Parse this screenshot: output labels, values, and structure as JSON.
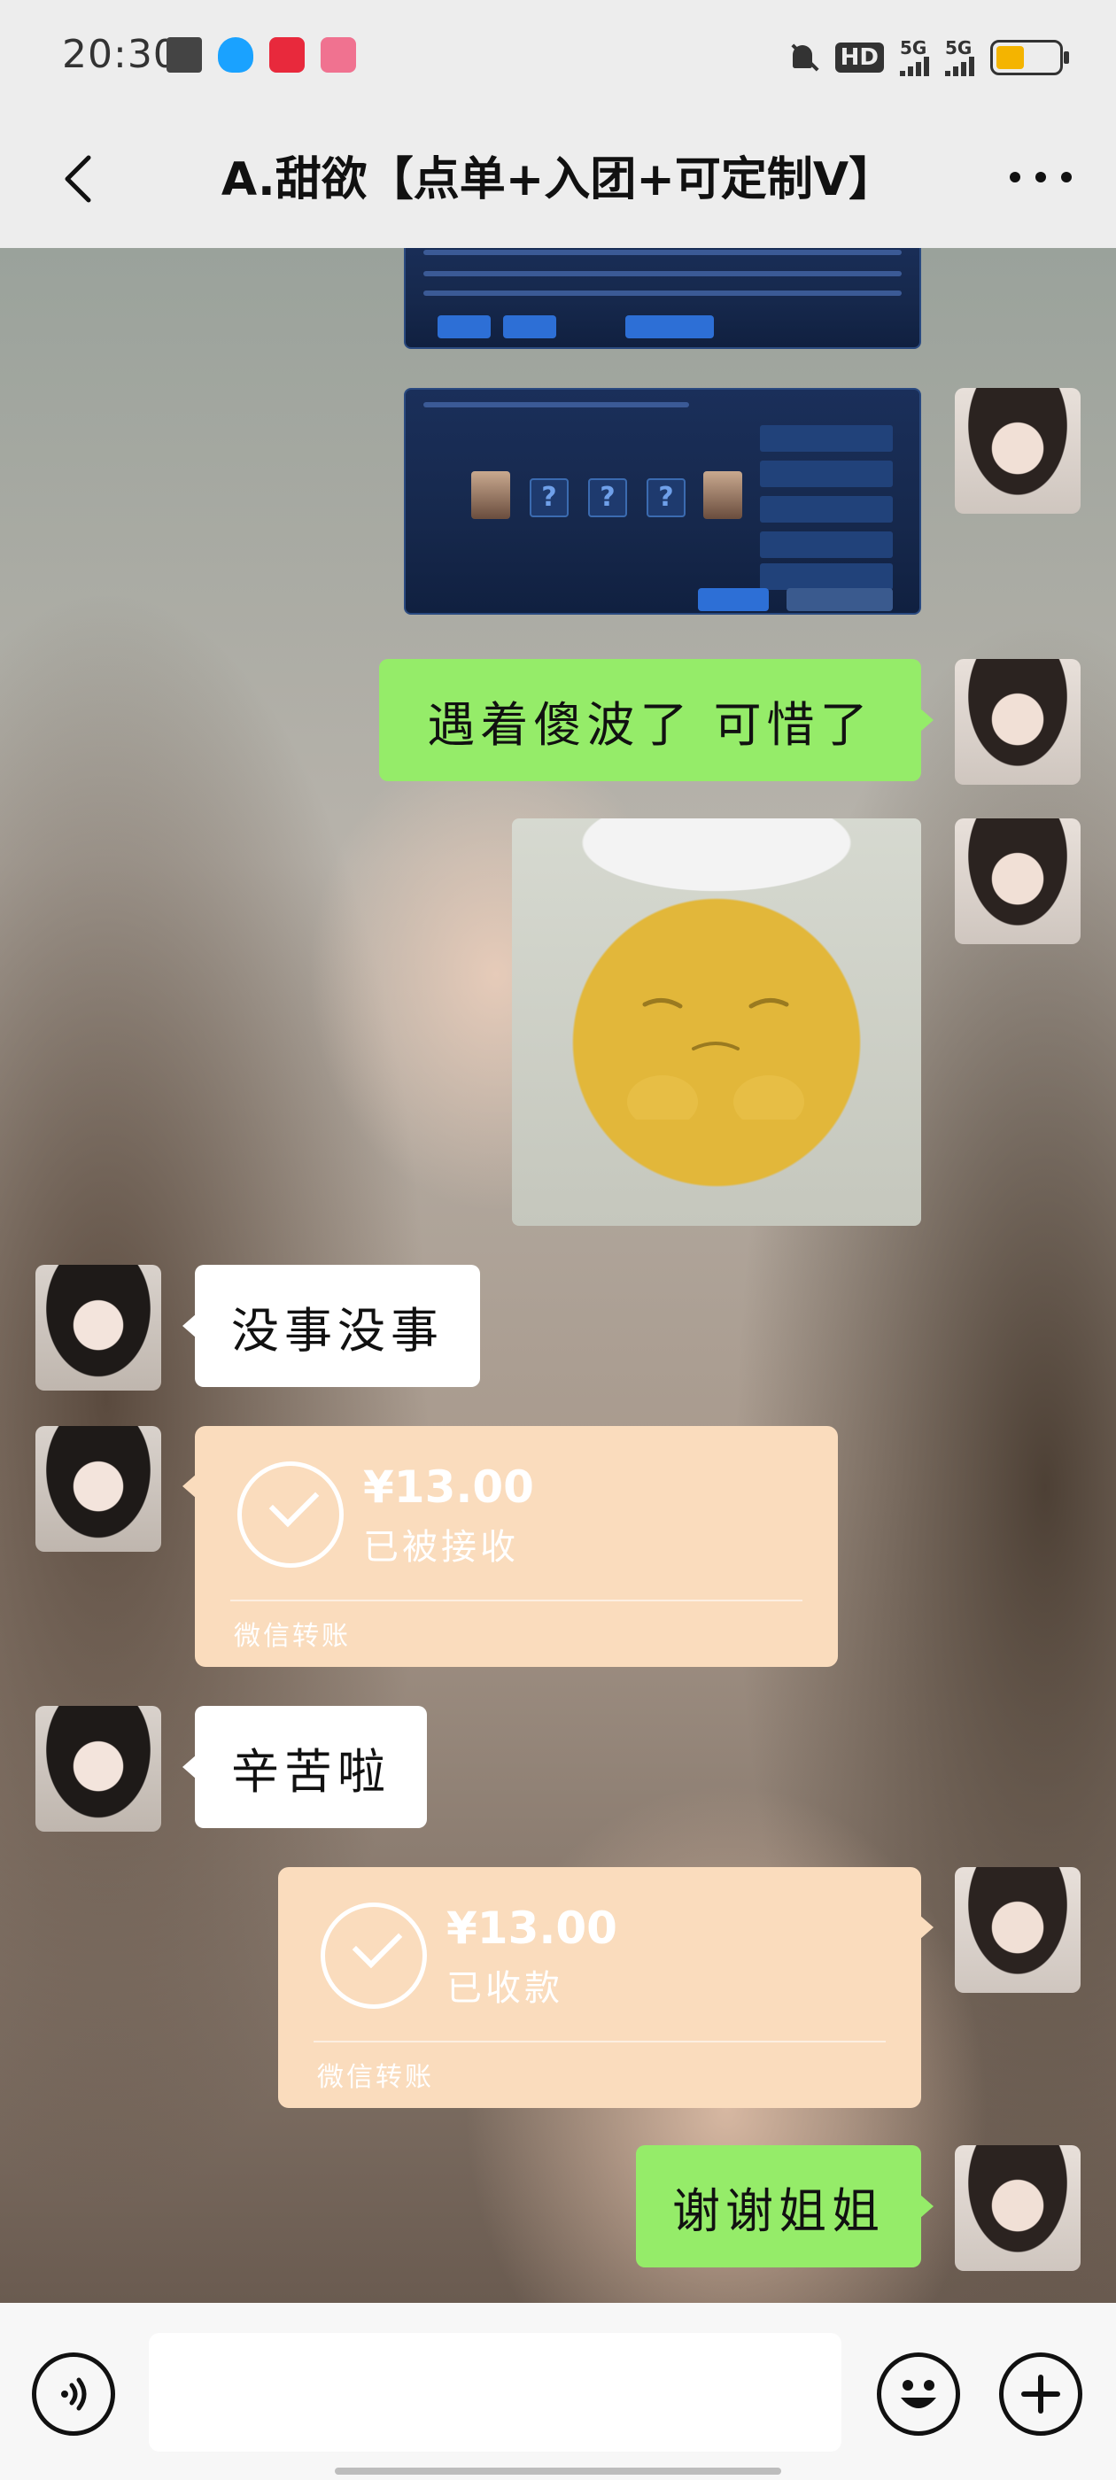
{
  "status_bar": {
    "time": "20:30",
    "hd_label": "HD",
    "signal_1_label": "5G",
    "signal_2_label": "5G",
    "battery_level": 0.45,
    "icons": [
      "stack-icon",
      "qq-icon",
      "app-icon-red",
      "app-icon-pink",
      "mute-icon",
      "battery-icon"
    ]
  },
  "header": {
    "title": "A.甜欲【点单+入团+可定制V】",
    "back_icon": "chevron-left-icon",
    "more_icon": "more-dots-icon"
  },
  "messages": [
    {
      "id": "m1",
      "side": "right",
      "type": "image",
      "content": "game-screenshot-partial"
    },
    {
      "id": "m2",
      "side": "right",
      "type": "image",
      "content": "game-screenshot-team"
    },
    {
      "id": "m3",
      "side": "right",
      "type": "text",
      "text": "遇着傻波了  可惜了"
    },
    {
      "id": "m4",
      "side": "right",
      "type": "image",
      "content": "sticker-yellow-character"
    },
    {
      "id": "m5",
      "side": "left",
      "type": "text",
      "text": "没事没事"
    },
    {
      "id": "m6",
      "side": "left",
      "type": "transfer",
      "amount": "¥13.00",
      "status": "已被接收",
      "footer": "微信转账"
    },
    {
      "id": "m7",
      "side": "left",
      "type": "text",
      "text": "辛苦啦"
    },
    {
      "id": "m8",
      "side": "right",
      "type": "transfer",
      "amount": "¥13.00",
      "status": "已收款",
      "footer": "微信转账"
    },
    {
      "id": "m9",
      "side": "right",
      "type": "text",
      "text": "谢谢姐姐"
    }
  ],
  "input_bar": {
    "input_value": "",
    "voice_icon": "voice-icon",
    "emoji_icon": "emoji-icon",
    "plus_icon": "plus-icon"
  },
  "colors": {
    "bubble_self": "#95ec69",
    "bubble_other": "#ffffff",
    "transfer": "#fadcbd",
    "bar_bg": "#ededed"
  }
}
